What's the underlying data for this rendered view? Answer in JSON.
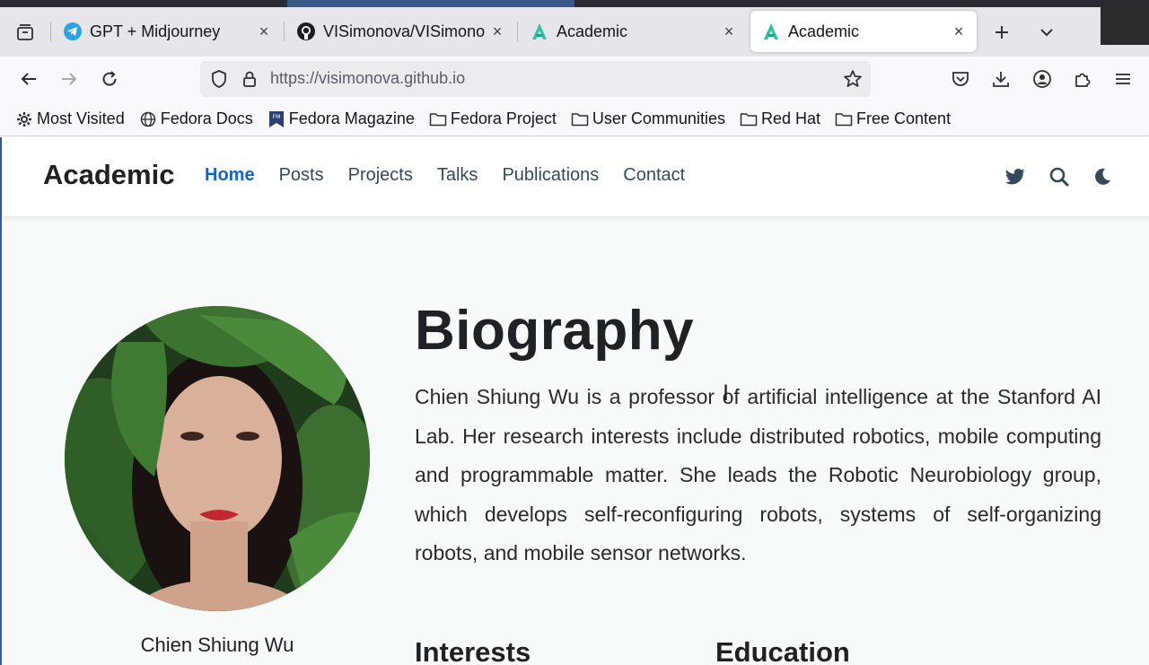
{
  "browser": {
    "tabs": [
      {
        "label": "GPT + Midjourney",
        "icon": "telegram-icon",
        "active": false
      },
      {
        "label": "VISimonova/VISimonova",
        "icon": "github-icon",
        "active": false
      },
      {
        "label": "Academic",
        "icon": "academic-logo-icon",
        "active": false
      },
      {
        "label": "Academic",
        "icon": "academic-logo-icon",
        "active": true
      }
    ],
    "close_glyph": "×",
    "url": "https://visimonova.github.io",
    "bookmarks": [
      {
        "label": "Most Visited",
        "icon": "gear-icon"
      },
      {
        "label": "Fedora Docs",
        "icon": "globe-icon"
      },
      {
        "label": "Fedora Magazine",
        "icon": "fedora-magazine-icon"
      },
      {
        "label": "Fedora Project",
        "icon": "folder-icon"
      },
      {
        "label": "User Communities",
        "icon": "folder-icon"
      },
      {
        "label": "Red Hat",
        "icon": "folder-icon"
      },
      {
        "label": "Free Content",
        "icon": "folder-icon"
      }
    ],
    "colors": {
      "accent": "#0060df",
      "tab_bar": "#e6e6ea"
    }
  },
  "site": {
    "brand": "Academic",
    "menu": [
      "Home",
      "Posts",
      "Projects",
      "Talks",
      "Publications",
      "Contact"
    ],
    "active_menu": "Home",
    "icons": [
      "twitter-icon",
      "search-icon",
      "moon-icon"
    ],
    "colors": {
      "link_active": "#1565c0",
      "menu_text": "#34495e"
    }
  },
  "main": {
    "person_name": "Chien Shiung Wu",
    "bio_title": "Biography",
    "bio_text": "Chien Shiung Wu is a professor of artificial intelligence at the Stanford AI Lab. Her research interests include distributed robotics, mobile computing and programmable matter. She leads the Robotic Neurobiology group, which develops self-reconfiguring robots, systems of self-organizing robots, and mobile sensor networks.",
    "interests_heading": "Interests",
    "education_heading": "Education"
  }
}
